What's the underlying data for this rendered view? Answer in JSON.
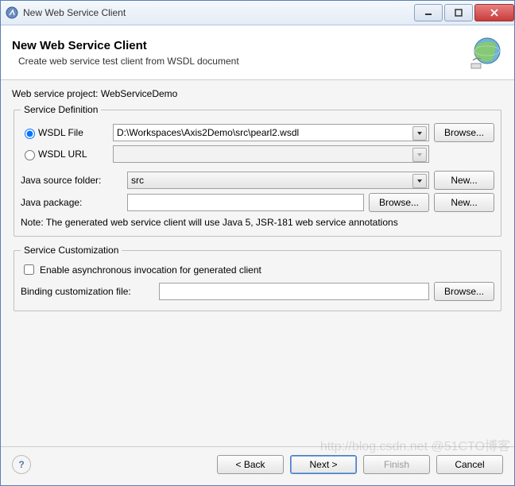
{
  "window": {
    "title": "New Web Service Client"
  },
  "header": {
    "title": "New Web Service Client",
    "description": "Create web service test client from WSDL document"
  },
  "project": {
    "label": "Web service project:",
    "value": "WebServiceDemo"
  },
  "serviceDefinition": {
    "legend": "Service Definition",
    "wsdlFile": {
      "label": "WSDL File",
      "value": "D:\\Workspaces\\Axis2Demo\\src\\pearl2.wsdl",
      "selected": true
    },
    "wsdlUrl": {
      "label": "WSDL URL",
      "value": ""
    },
    "browse": "Browse...",
    "javaSourceFolder": {
      "label": "Java source folder:",
      "value": "src",
      "newBtn": "New..."
    },
    "javaPackage": {
      "label": "Java package:",
      "value": "",
      "browse": "Browse...",
      "newBtn": "New..."
    },
    "note": "Note: The generated web service client will use Java 5, JSR-181 web service annotations"
  },
  "serviceCustomization": {
    "legend": "Service Customization",
    "enableAsync": {
      "label": "Enable asynchronous invocation for generated client",
      "checked": false
    },
    "bindingFile": {
      "label": "Binding customization file:",
      "value": "",
      "browse": "Browse..."
    }
  },
  "footer": {
    "back": "< Back",
    "next": "Next >",
    "finish": "Finish",
    "cancel": "Cancel"
  },
  "watermark": "http://blog.csdn.net @51CTO博客"
}
